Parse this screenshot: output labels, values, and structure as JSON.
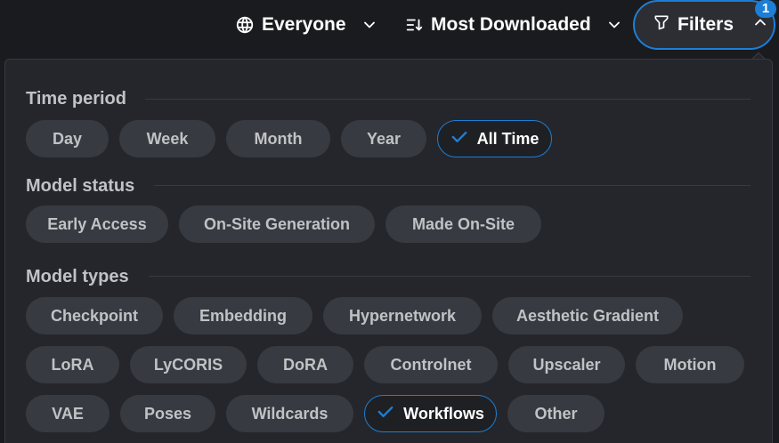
{
  "topbar": {
    "browsing_level": "Everyone",
    "sort": "Most Downloaded",
    "filters_label": "Filters",
    "filters_count": "1"
  },
  "sections": {
    "time_period": {
      "title": "Time period",
      "options": [
        "Day",
        "Week",
        "Month",
        "Year",
        "All Time"
      ],
      "selected": "All Time"
    },
    "model_status": {
      "title": "Model status",
      "options": [
        "Early Access",
        "On-Site Generation",
        "Made On-Site"
      ]
    },
    "model_types": {
      "title": "Model types",
      "options": [
        "Checkpoint",
        "Embedding",
        "Hypernetwork",
        "Aesthetic Gradient",
        "LoRA",
        "LyCORIS",
        "DoRA",
        "Controlnet",
        "Upscaler",
        "Motion",
        "VAE",
        "Poses",
        "Wildcards",
        "Workflows",
        "Other"
      ],
      "selected": "Workflows"
    }
  },
  "colors": {
    "accent": "#1c7ed6",
    "chip_bg": "#373a40",
    "panel_bg": "#25262b"
  }
}
